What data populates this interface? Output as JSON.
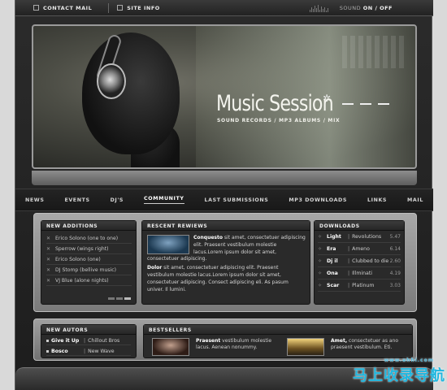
{
  "topbar": {
    "contact": "CONTACT MAIL",
    "site_info": "SITE INFO",
    "sound_label": "SOUND",
    "sound_state": "ON / OFF"
  },
  "hero": {
    "title": "Music Session",
    "subtitle": "SOUND RECORDS / MP3 ALBUMS / MIX"
  },
  "nav": [
    "NEWS",
    "EVENTS",
    "DJ'S",
    "COMMUNITY",
    "LAST SUBMISSIONS",
    "MP3 DOWNLOADS",
    "LINKS",
    "MAIL"
  ],
  "nav_active": "COMMUNITY",
  "new_additions": {
    "title": "NEW ADDITIONS",
    "items": [
      "Erico Solono (one to one)",
      "Sperrow (wings right)",
      "Erico Solono (one)",
      "DJ Stomp (bellive music)",
      "VJ Blue (alone nights)"
    ]
  },
  "reviews": {
    "title": "RESCENT REWIEWS",
    "r1_name": "Conquesto",
    "r1_text": " sit amet, consectetuer adipiscing elit. Praesent vestibulum molestie lacus.Lorem ipsum dolor sit amet, consectetuer adipiscing.",
    "r2_name": "Dolor",
    "r2_text": " sit amet, consectetuer adipiscing elit. Praesent vestibulum molestie lacus.Lorem ipsum dolor sit amet, consectetuer adipiscing. Consect adipiscing eli. As pasum univer. Il lumini."
  },
  "downloads": {
    "title": "DOWNLOADS",
    "rows": [
      {
        "name": "Light",
        "album": "Revolutions",
        "price": "5.47"
      },
      {
        "name": "Era",
        "album": "Ameno",
        "price": "6.14"
      },
      {
        "name": "Dj il",
        "album": "Clubbed to die",
        "price": "2.60"
      },
      {
        "name": "Ona",
        "album": "Illminati",
        "price": "4.19"
      },
      {
        "name": "Scar",
        "album": "Platinum",
        "price": "3.03"
      }
    ]
  },
  "new_autors": {
    "title": "NEW AUTORS",
    "rows": [
      {
        "name": "Give it Up",
        "album": "Chillout Bros"
      },
      {
        "name": "Bosco",
        "album": "New Wave"
      }
    ]
  },
  "bestsellers": {
    "title": "BESTSELLERS",
    "i1_name": "Praesent",
    "i1_text": " vestibulum molestie lacus. Aenean nonummy.",
    "i2_name": "Amet,",
    "i2_text": " consectetuer as ano praesent vestibulum. Eti."
  },
  "watermark": "马上收录导航",
  "watermark_sub": "www.ahhi.com"
}
